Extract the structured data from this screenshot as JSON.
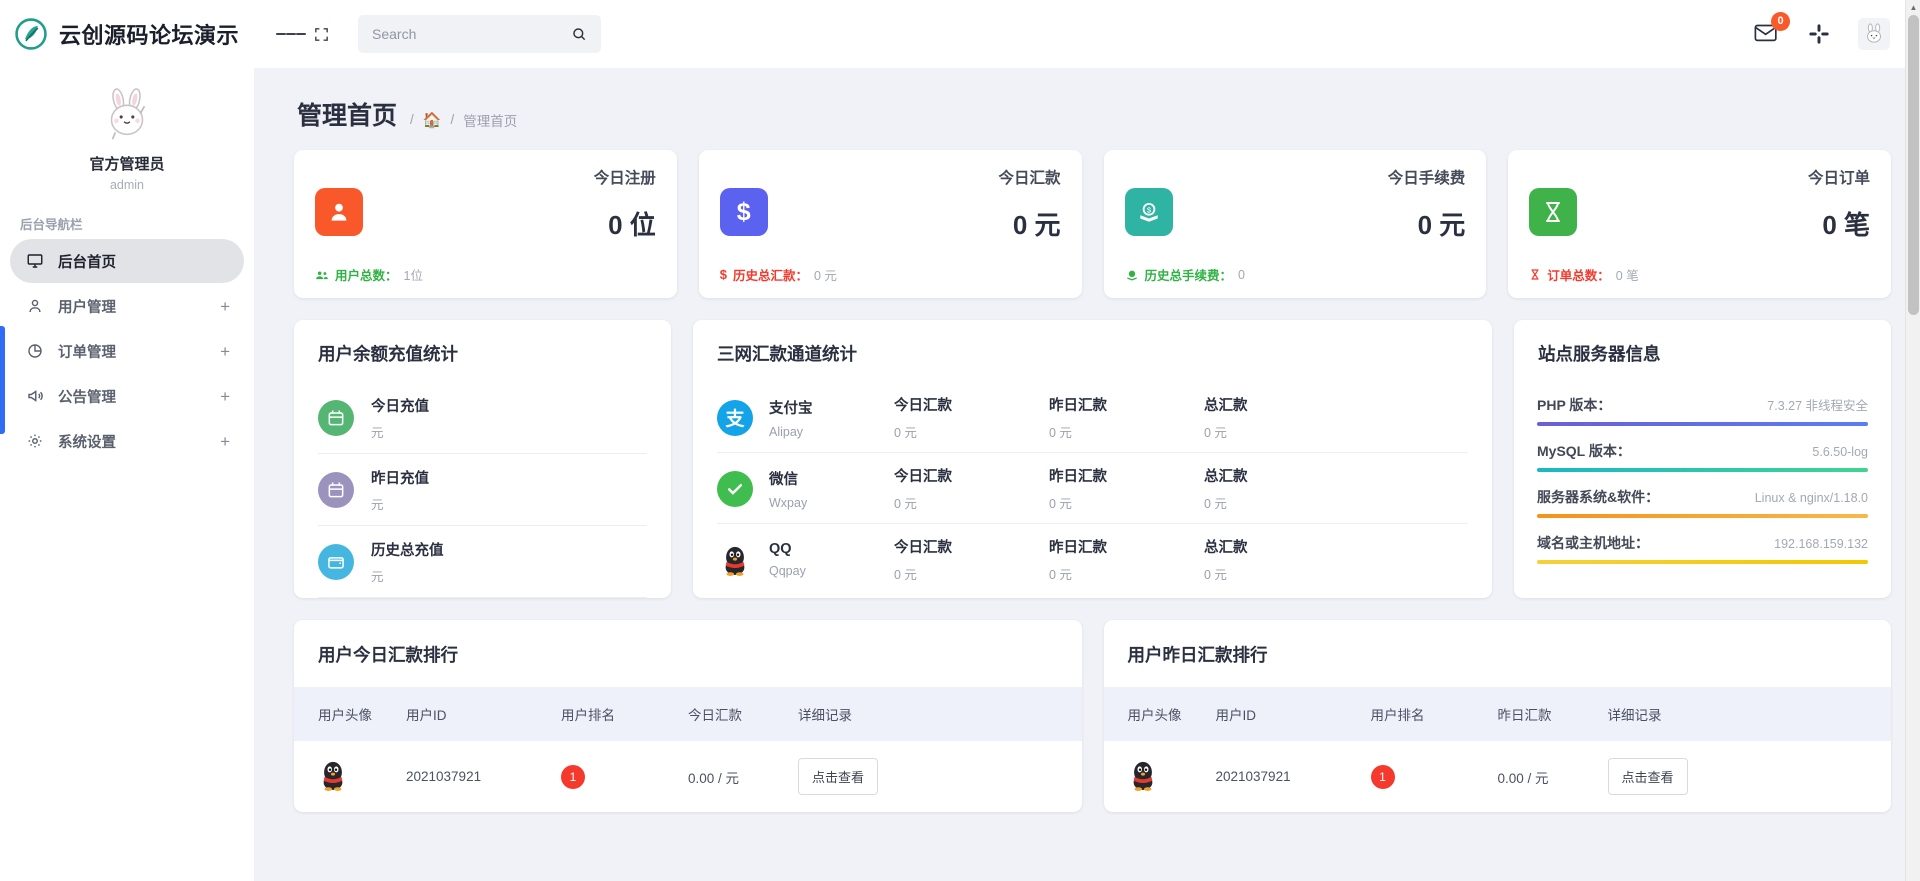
{
  "brand": {
    "name": "云创源码论坛演示",
    "logo_icon": "leaf-circle-logo"
  },
  "profile": {
    "avatar_icon": "rabbit-avatar",
    "name": "官方管理员",
    "role": "admin"
  },
  "sidebar": {
    "nav_title": "后台导航栏",
    "items": [
      {
        "label": "后台首页",
        "icon": "monitor-icon",
        "expandable": false,
        "active": true
      },
      {
        "label": "用户管理",
        "icon": "user-icon",
        "expandable": true,
        "plus": "+",
        "active": false
      },
      {
        "label": "订单管理",
        "icon": "pie-chart-icon",
        "expandable": true,
        "plus": "+",
        "active": false
      },
      {
        "label": "公告管理",
        "icon": "megaphone-icon",
        "expandable": true,
        "plus": "+",
        "active": false
      },
      {
        "label": "系统设置",
        "icon": "gear-icon",
        "expandable": true,
        "plus": "+",
        "active": false
      }
    ]
  },
  "topbar": {
    "menu_icon": "hamburger-icon",
    "fullscreen_icon": "fullscreen-icon",
    "search": {
      "placeholder": "Search",
      "value": "",
      "icon": "search-icon"
    },
    "mail": {
      "icon": "envelope-icon",
      "badge": "0"
    },
    "apps_icon": "slack-apps-icon",
    "avatar_icon": "rabbit-avatar"
  },
  "page": {
    "title": "管理首页",
    "breadcrumb": {
      "sep": "/",
      "home_icon": "home-icon",
      "current": "管理首页"
    }
  },
  "stats": [
    {
      "label": "今日注册",
      "value": "0 位",
      "icon": "user-card-icon",
      "color": "#f9582a",
      "foot_icon": "users-icon",
      "foot_label": "用户总数：",
      "foot_value": "1位",
      "foot_color": "#2fb344"
    },
    {
      "label": "今日汇款",
      "value": "0 元",
      "icon": "dollar-icon",
      "color": "#5c62f0",
      "foot_icon": "dollar-sign-icon",
      "foot_label": "历史总汇款：",
      "foot_value": "0 元",
      "foot_color": "#f5392c"
    },
    {
      "label": "今日手续费",
      "value": "0 元",
      "icon": "coin-deposit-icon",
      "color": "#2fb3a2",
      "foot_icon": "coin-icon",
      "foot_label": "历史总手续费：",
      "foot_value": "0",
      "foot_color": "#2fb344"
    },
    {
      "label": "今日订单",
      "value": "0 笔",
      "icon": "hourglass-icon",
      "color": "#3fb24a",
      "foot_icon": "hourglass-small-icon",
      "foot_label": "订单总数：",
      "foot_value": "0 笔",
      "foot_color": "#f5392c"
    }
  ],
  "balance_panel": {
    "title": "用户余额充值统计",
    "items": [
      {
        "name": "今日充值",
        "unit": "元",
        "icon": "calendar-today-icon",
        "color": "#55b573"
      },
      {
        "name": "昨日充值",
        "unit": "元",
        "icon": "calendar-yesterday-icon",
        "color": "#9b93bd"
      },
      {
        "name": "历史总充值",
        "unit": "元",
        "icon": "wallet-icon",
        "color": "#45b6e0"
      }
    ]
  },
  "channel_panel": {
    "title": "三网汇款通道统计",
    "rows": [
      {
        "name": "支付宝",
        "sub": "Alipay",
        "icon": "alipay-icon",
        "cells": [
          {
            "k": "今日汇款",
            "v": "0 元"
          },
          {
            "k": "昨日汇款",
            "v": "0 元"
          },
          {
            "k": "总汇款",
            "v": "0 元"
          }
        ]
      },
      {
        "name": "微信",
        "sub": "Wxpay",
        "icon": "wechat-icon",
        "cells": [
          {
            "k": "今日汇款",
            "v": "0 元"
          },
          {
            "k": "昨日汇款",
            "v": "0 元"
          },
          {
            "k": "总汇款",
            "v": "0 元"
          }
        ]
      },
      {
        "name": "QQ",
        "sub": "Qqpay",
        "icon": "qq-penguin-icon",
        "cells": [
          {
            "k": "今日汇款",
            "v": "0 元"
          },
          {
            "k": "昨日汇款",
            "v": "0 元"
          },
          {
            "k": "总汇款",
            "v": "0 元"
          }
        ]
      }
    ]
  },
  "server_panel": {
    "title": "站点服务器信息",
    "items": [
      {
        "key": "PHP 版本：",
        "value": "7.3.27 非线程安全",
        "bar_from": "#6a5fd6",
        "bar_to": "#5a7ef0"
      },
      {
        "key": "MySQL 版本：",
        "value": "5.6.50-log",
        "bar_from": "#19b8c4",
        "bar_to": "#3fd493"
      },
      {
        "key": "服务器系统&软件：",
        "value": "Linux & nginx/1.18.0",
        "bar_from": "#f5921b",
        "bar_to": "#f7b84b"
      },
      {
        "key": "域名或主机地址：",
        "value": "192.168.159.132",
        "bar_from": "#f4d13a",
        "bar_to": "#f2c800"
      }
    ]
  },
  "tables": [
    {
      "title": "用户今日汇款排行",
      "columns": [
        "用户头像",
        "用户ID",
        "用户排名",
        "今日汇款",
        "详细记录"
      ],
      "rows": [
        {
          "avatar_icon": "qq-penguin-avatar",
          "id": "2021037921",
          "rank": "1",
          "amount": "0.00 / 元",
          "action": "点击查看"
        }
      ]
    },
    {
      "title": "用户昨日汇款排行",
      "columns": [
        "用户头像",
        "用户ID",
        "用户排名",
        "昨日汇款",
        "详细记录"
      ],
      "rows": [
        {
          "avatar_icon": "qq-penguin-avatar",
          "id": "2021037921",
          "rank": "1",
          "amount": "0.00 / 元",
          "action": "点击查看"
        }
      ]
    }
  ]
}
